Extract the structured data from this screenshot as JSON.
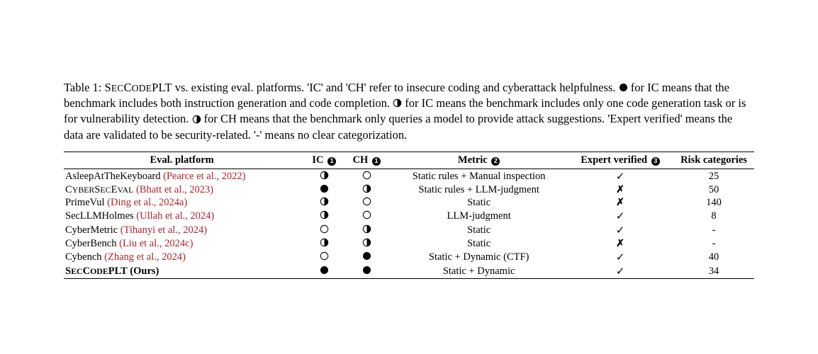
{
  "caption": {
    "prefix": "Table 1: ",
    "body_parts": [
      "S",
      "EC",
      "C",
      "ODE",
      "PLT",
      " vs. existing eval. platforms. 'IC' and 'CH' refer to insecure coding and cyberattack helpfulness. ",
      " for IC means that the benchmark includes both instruction generation and code completion. ",
      " for IC means the benchmark includes only one code generation task or is for vulnerability detection. ",
      " for CH means that the benchmark only queries a model to provide attack suggestions. 'Expert verified' means the data are validated to be security-related. '-' means no clear categorization."
    ]
  },
  "headers": {
    "platform": "Eval. platform",
    "ic": "IC",
    "ch": "CH",
    "metric": "Metric",
    "expert": "Expert verified",
    "risk": "Risk categories",
    "note1": "1",
    "note2": "2",
    "note3": "3"
  },
  "rows": [
    {
      "name": "AsleepAtTheKeyboard",
      "cite": "(Pearce et al., 2022)",
      "ic": "half",
      "ch": "empty",
      "metric": "Static rules + Manual inspection",
      "expert": "check",
      "risk": "25"
    },
    {
      "name_sc_parts": [
        "C",
        "YBER",
        "S",
        "EC",
        "E",
        "VAL"
      ],
      "cite": "(Bhatt et al., 2023)",
      "ic": "full",
      "ch": "half",
      "metric": "Static rules + LLM-judgment",
      "expert": "cross",
      "risk": "50"
    },
    {
      "name": "PrimeVul",
      "cite": "(Ding et al., 2024a)",
      "ic": "half",
      "ch": "empty",
      "metric": "Static",
      "expert": "cross",
      "risk": "140"
    },
    {
      "name": "SecLLMHolmes",
      "cite": "(Ullah et al., 2024)",
      "ic": "half",
      "ch": "empty",
      "metric": "LLM-judgment",
      "expert": "check",
      "risk": "8"
    },
    {
      "name": "CyberMetric",
      "cite": "(Tihanyi et al., 2024)",
      "ic": "empty",
      "ch": "half",
      "metric": "Static",
      "expert": "check",
      "risk": "-"
    },
    {
      "name": "CyberBench",
      "cite": "(Liu et al., 2024c)",
      "ic": "half",
      "ch": "half",
      "metric": "Static",
      "expert": "cross",
      "risk": "-"
    },
    {
      "name": "Cybench",
      "cite": "(Zhang et al., 2024)",
      "ic": "empty",
      "ch": "full",
      "metric": "Static + Dynamic (CTF)",
      "expert": "check",
      "risk": "40"
    },
    {
      "name_sc_parts": [
        "S",
        "EC",
        "C",
        "ODE",
        "PLT"
      ],
      "suffix": " (Ours)",
      "bold": true,
      "ic": "full",
      "ch": "full",
      "metric": "Static + Dynamic",
      "expert": "check",
      "risk": "34"
    }
  ],
  "chart_data": {
    "type": "table",
    "title": "SECCODEPLT vs. existing eval. platforms",
    "columns": [
      "Eval. platform",
      "IC",
      "CH",
      "Metric",
      "Expert verified",
      "Risk categories"
    ],
    "legend": {
      "IC_full": "benchmark includes both instruction generation and code completion",
      "IC_half": "benchmark includes only one code generation task or is for vulnerability detection",
      "CH_half": "benchmark only queries a model to provide attack suggestions",
      "expert_verified": "data are validated to be security-related",
      "dash": "no clear categorization"
    },
    "rows": [
      {
        "platform": "AsleepAtTheKeyboard (Pearce et al., 2022)",
        "IC": "half",
        "CH": "empty",
        "Metric": "Static rules + Manual inspection",
        "Expert verified": true,
        "Risk categories": 25
      },
      {
        "platform": "CYBERSECEVAL (Bhatt et al., 2023)",
        "IC": "full",
        "CH": "half",
        "Metric": "Static rules + LLM-judgment",
        "Expert verified": false,
        "Risk categories": 50
      },
      {
        "platform": "PrimeVul (Ding et al., 2024a)",
        "IC": "half",
        "CH": "empty",
        "Metric": "Static",
        "Expert verified": false,
        "Risk categories": 140
      },
      {
        "platform": "SecLLMHolmes (Ullah et al., 2024)",
        "IC": "half",
        "CH": "empty",
        "Metric": "LLM-judgment",
        "Expert verified": true,
        "Risk categories": 8
      },
      {
        "platform": "CyberMetric (Tihanyi et al., 2024)",
        "IC": "empty",
        "CH": "half",
        "Metric": "Static",
        "Expert verified": true,
        "Risk categories": null
      },
      {
        "platform": "CyberBench (Liu et al., 2024c)",
        "IC": "half",
        "CH": "half",
        "Metric": "Static",
        "Expert verified": false,
        "Risk categories": null
      },
      {
        "platform": "Cybench (Zhang et al., 2024)",
        "IC": "empty",
        "CH": "full",
        "Metric": "Static + Dynamic (CTF)",
        "Expert verified": true,
        "Risk categories": 40
      },
      {
        "platform": "SECCODEPLT (Ours)",
        "IC": "full",
        "CH": "full",
        "Metric": "Static + Dynamic",
        "Expert verified": true,
        "Risk categories": 34
      }
    ]
  }
}
